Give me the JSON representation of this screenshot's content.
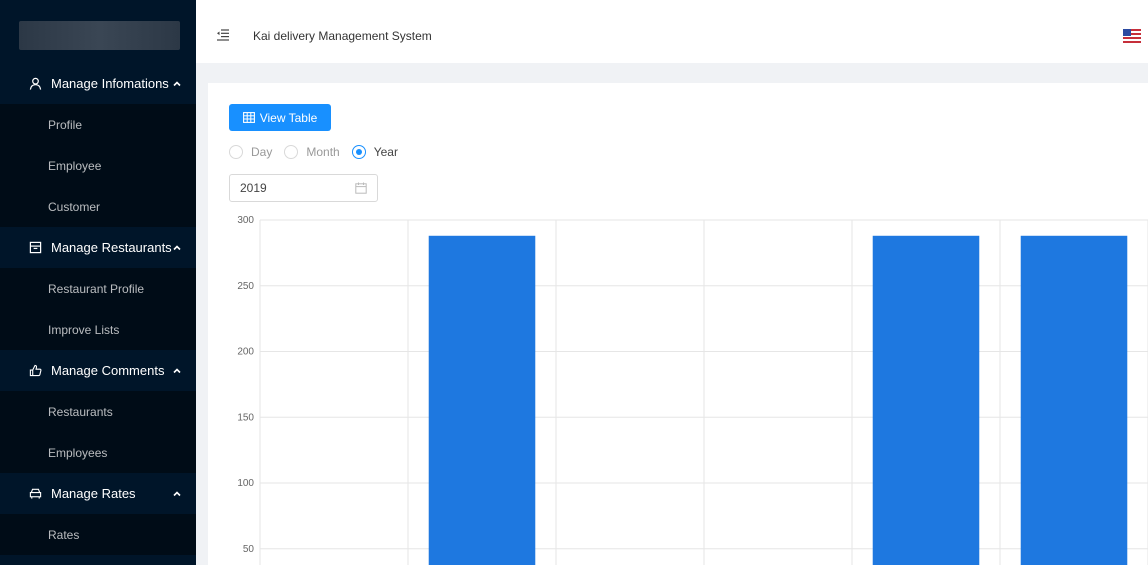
{
  "sidebar": {
    "groups": [
      {
        "label": "Manage Infomations",
        "icon": "user-icon",
        "items": [
          "Profile",
          "Employee",
          "Customer"
        ]
      },
      {
        "label": "Manage Restaurants",
        "icon": "shop-icon",
        "items": [
          "Restaurant Profile",
          "Improve Lists"
        ]
      },
      {
        "label": "Manage Comments",
        "icon": "like-icon",
        "items": [
          "Restaurants",
          "Employees"
        ]
      },
      {
        "label": "Manage Rates",
        "icon": "car-icon",
        "items": [
          "Rates"
        ]
      }
    ]
  },
  "header": {
    "title": "Kai delivery Management System",
    "fold_icon": "menu-fold-icon",
    "language_flag": "us-flag-icon"
  },
  "toolbar": {
    "view_table_label": "View Table",
    "view_table_icon": "table-icon"
  },
  "period": {
    "options": [
      "Day",
      "Month",
      "Year"
    ],
    "selected": "Year"
  },
  "date_picker": {
    "value": "2019",
    "icon": "calendar-icon"
  },
  "colors": {
    "sidebar_bg": "#001529",
    "submenu_bg": "#000c17",
    "primary": "#1890ff",
    "bar": "#1e78e0"
  },
  "chart_data": {
    "type": "bar",
    "title": "",
    "xlabel": "",
    "ylabel": "",
    "ylim": [
      0,
      300
    ],
    "yticks": [
      50,
      100,
      150,
      200,
      250,
      300
    ],
    "categories": [
      "",
      "",
      "",
      "",
      "",
      ""
    ],
    "values": [
      0,
      288,
      0,
      0,
      288,
      288
    ],
    "grid": true
  }
}
